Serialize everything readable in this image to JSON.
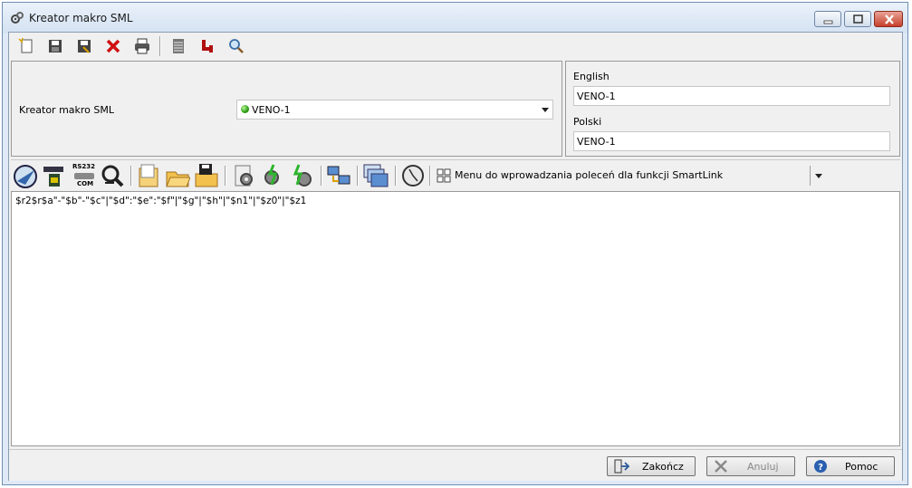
{
  "window": {
    "title": "Kreator makro SML",
    "icons": {
      "app": "gears-icon",
      "minimize": "minimize-icon",
      "maximize": "maximize-icon",
      "close": "close-icon"
    }
  },
  "toolbar": {
    "items": [
      "new-icon",
      "save-icon",
      "save-as-icon",
      "delete-icon",
      "print-icon",
      "list-icon",
      "tree-icon",
      "search-icon"
    ]
  },
  "properties": {
    "label": "Kreator makro SML",
    "selected_value": "VENO-1",
    "status_color": "#2a9d14",
    "english_label": "English",
    "english_value": "VENO-1",
    "polish_label": "Polski",
    "polish_value": "VENO-1"
  },
  "macro_toolbar": {
    "items": [
      "navigator-icon",
      "device-icon",
      "rs232-com-icon",
      "search-link-icon",
      "document-icon",
      "open-folder-icon",
      "save-folder-icon",
      "settings-icon",
      "run-settings-icon",
      "advanced-settings-icon",
      "network-icon",
      "layers-icon",
      "clock-icon"
    ],
    "rs232_label": "RS232",
    "com_label": "COM",
    "menu_label": "Menu do wprowadzania poleceń dla funkcji SmartLink"
  },
  "editor": {
    "content": "$r2$r$a\"-\"$b\"-\"$c\"|\"$d\":\"$e\":\"$f\"|\"$g\"|\"$h\"|\"$n1\"|\"$z0\"|\"$z1"
  },
  "buttons": {
    "finish": "Zakończ",
    "cancel": "Anuluj",
    "help": "Pomoc"
  }
}
